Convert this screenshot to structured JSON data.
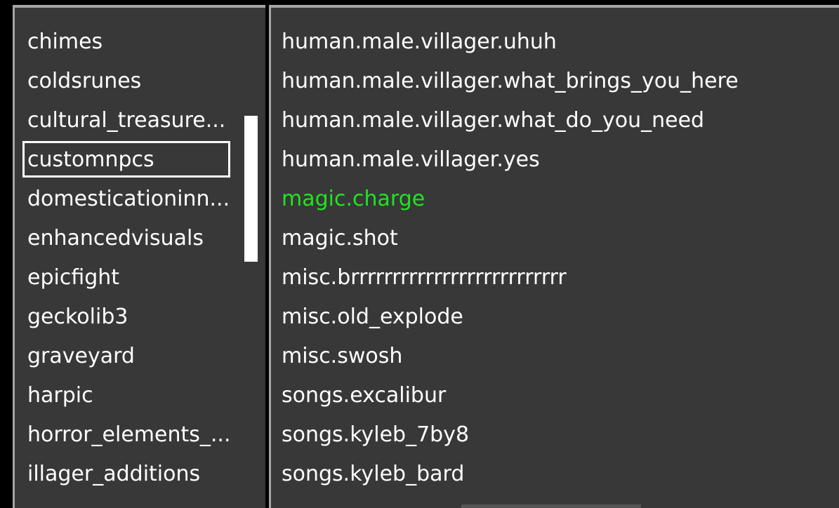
{
  "left_list": {
    "items": [
      "chimes",
      "coldsrunes",
      "cultural_treasure...",
      "customnpcs",
      "domesticationinn...",
      "enhancedvisuals",
      "epicfight",
      "geckolib3",
      "graveyard",
      "harpic",
      "horror_elements_...",
      "illager_additions"
    ],
    "selected_index": 3
  },
  "right_list": {
    "items": [
      "human.male.villager.uhuh",
      "human.male.villager.what_brings_you_here",
      "human.male.villager.what_do_you_need",
      "human.male.villager.yes",
      "magic.charge",
      "magic.shot",
      "misc.brrrrrrrrrrrrrrrrrrrrrrrrrr",
      "misc.old_explode",
      "misc.swosh",
      "songs.excalibur",
      "songs.kyleb_7by8",
      "songs.kyleb_bard"
    ],
    "highlighted_index": 4,
    "highlight_color": "#1fe51f"
  },
  "colors": {
    "panel_bg": "#383838",
    "border": "#a6a6a6",
    "text": "#ffffff"
  }
}
